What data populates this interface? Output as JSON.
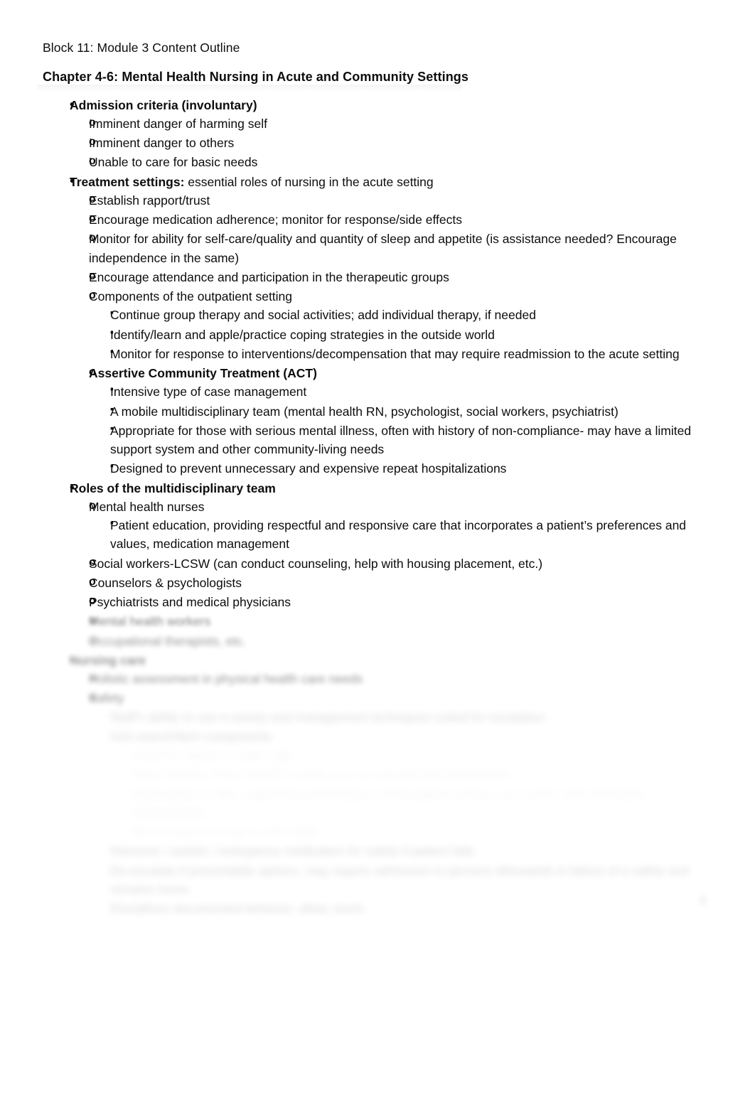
{
  "document": {
    "title": "Block 11: Module 3 Content Outline",
    "chapter_heading": "Chapter 4-6: Mental Health Nursing in Acute and Community Settings",
    "page_number": "1"
  },
  "outline": {
    "admission": {
      "heading": "Admission criteria (involuntary)",
      "items": [
        "Imminent danger of harming self",
        "Imminent danger to others",
        "Unable to care for basic needs"
      ]
    },
    "treatment": {
      "heading_bold": "Treatment settings:",
      "heading_rest": " essential roles of nursing in the acute setting",
      "items": [
        "Establish rapport/trust",
        "Encourage medication adherence; monitor for response/side effects",
        "Monitor for ability for self-care/quality and quantity of sleep and appetite (is assistance needed? Encourage independence in the same)",
        "Encourage attendance and participation in the therapeutic groups"
      ],
      "outpatient": {
        "heading": "Components of the outpatient setting",
        "items": [
          "Continue group therapy and social activities; add individual therapy, if needed",
          "Identify/learn and apple/practice coping strategies in the outside world",
          "Monitor for response to interventions/decompensation that may require readmission to the acute setting"
        ]
      },
      "act": {
        "heading": "Assertive Community Treatment (ACT)",
        "items": [
          "Intensive type of case management",
          "A mobile multidisciplinary team (mental health RN, psychologist, social workers, psychiatrist)",
          "Appropriate for those with serious mental illness, often with history of non-compliance- may have a limited support system and other community-living needs",
          "Designed to prevent unnecessary and expensive repeat hospitalizations"
        ]
      }
    },
    "roles": {
      "heading": "Roles of the multidisciplinary team",
      "nurses": {
        "heading": "Mental health nurses",
        "items": [
          "Patient education, providing respectful and responsive care that incorporates a patient’s preferences and values, medication management"
        ]
      },
      "items": [
        "Social workers-LCSW (can conduct counseling, help with housing placement, etc.)",
        "Counselors & psychologists",
        "Psychiatrists and medical physicians"
      ],
      "obscured_items": [
        "Mental health workers",
        "Occupational therapists, etc."
      ]
    },
    "obscured_section": {
      "heading": "Nursing care",
      "items": [
        "Holistic assessment in physical health care needs",
        "Safety"
      ],
      "safety_items": [
        "Staff's ability to use a variety and management techniques suited for escalation",
        "Unit search/Item components"
      ],
      "unit_search_items": [
        "Used for objects in plain sight",
        "Open mouths of the mouth to make sure no one pills the liquid health",
        "Observation is little, organizing and finding in what patient surface, not screen with medication administration",
        "Monitoring the things in self-safety"
      ],
      "trailing_items": [
        "Intensive / assists / emergency medication for safety if patient fails",
        "De-escalate if preventable options, may require admission to persons afterwards in failure of a safety and remains home",
        "Disciplines documented behavior, allow, touch"
      ]
    }
  }
}
